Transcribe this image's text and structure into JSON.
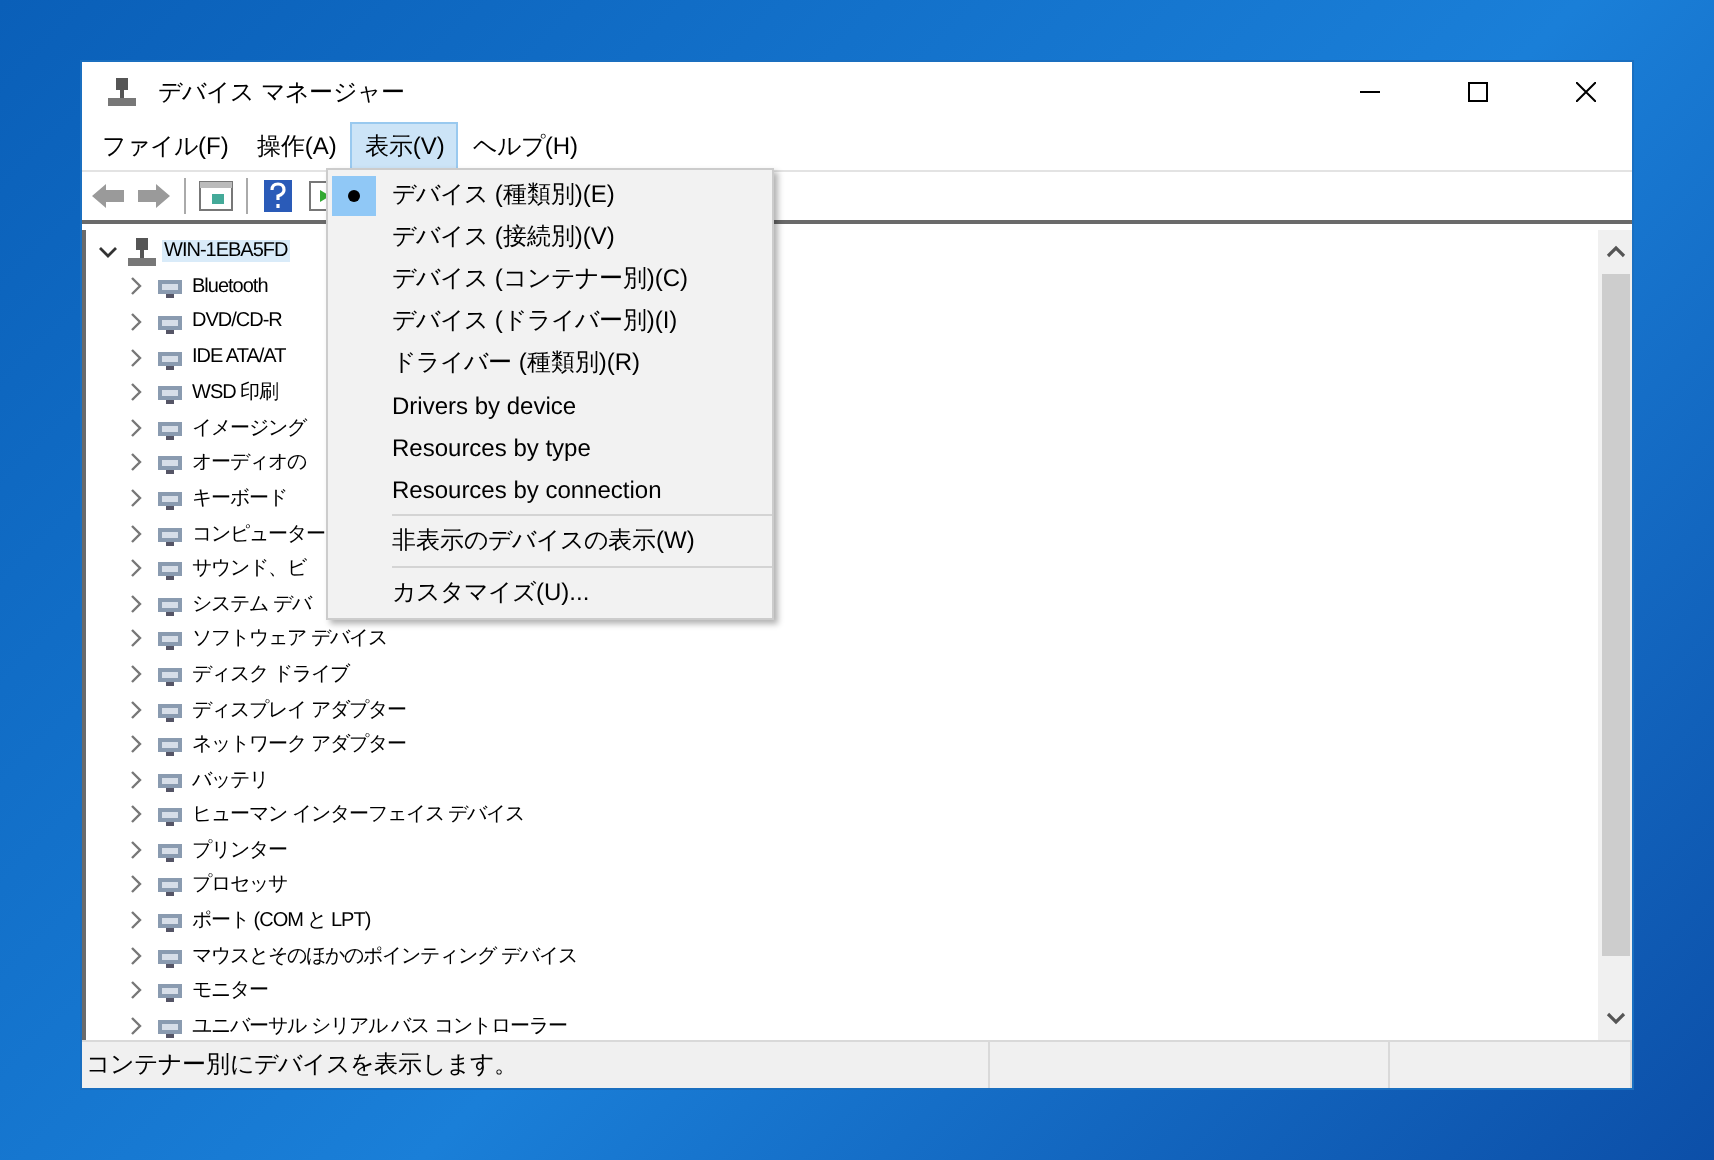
{
  "window": {
    "title": "デバイス マネージャー"
  },
  "menu_bar": [
    {
      "label": "ファイル(F)",
      "selected": false
    },
    {
      "label": "操作(A)",
      "selected": false
    },
    {
      "label": "表示(V)",
      "selected": true
    },
    {
      "label": "ヘルプ(H)",
      "selected": false
    }
  ],
  "view_menu": [
    {
      "kind": "item",
      "label": "デバイス (種類別)(E)",
      "checked": true
    },
    {
      "kind": "item",
      "label": "デバイス (接続別)(V)",
      "checked": false
    },
    {
      "kind": "item",
      "label": "デバイス (コンテナー別)(C)",
      "checked": false
    },
    {
      "kind": "item",
      "label": "デバイス (ドライバー別)(I)",
      "checked": false
    },
    {
      "kind": "item",
      "label": "ドライバー (種類別)(R)",
      "checked": false
    },
    {
      "kind": "item",
      "label": "Drivers by device",
      "checked": false
    },
    {
      "kind": "item",
      "label": "Resources by type",
      "checked": false
    },
    {
      "kind": "item",
      "label": "Resources by connection",
      "checked": false
    },
    {
      "kind": "separator"
    },
    {
      "kind": "item",
      "label": "非表示のデバイスの表示(W)",
      "checked": false
    },
    {
      "kind": "separator"
    },
    {
      "kind": "item",
      "label": "カスタマイズ(U)...",
      "checked": false
    }
  ],
  "tree": {
    "label": "WIN-1EBA5FD",
    "expanded": true,
    "selected": true,
    "children": [
      {
        "label": "Bluetooth",
        "expanded": false
      },
      {
        "label": "DVD/CD-R",
        "expanded": false
      },
      {
        "label": "IDE ATA/AT",
        "expanded": false
      },
      {
        "label": "WSD 印刷",
        "expanded": false
      },
      {
        "label": "イメージング",
        "expanded": false
      },
      {
        "label": "オーディオの",
        "expanded": false
      },
      {
        "label": "キーボード",
        "expanded": false
      },
      {
        "label": "コンピューター",
        "expanded": false
      },
      {
        "label": "サウンド、ビ",
        "expanded": false
      },
      {
        "label": "システム デバ",
        "expanded": false
      },
      {
        "label": "ソフトウェア デバイス",
        "expanded": false
      },
      {
        "label": "ディスク ドライブ",
        "expanded": false
      },
      {
        "label": "ディスプレイ アダプター",
        "expanded": false
      },
      {
        "label": "ネットワーク アダプター",
        "expanded": false
      },
      {
        "label": "バッテリ",
        "expanded": false
      },
      {
        "label": "ヒューマン インターフェイス デバイス",
        "expanded": false
      },
      {
        "label": "プリンター",
        "expanded": false
      },
      {
        "label": "プロセッサ",
        "expanded": false
      },
      {
        "label": "ポート (COM と LPT)",
        "expanded": false
      },
      {
        "label": "マウスとそのほかのポインティング デバイス",
        "expanded": false
      },
      {
        "label": "モニター",
        "expanded": false
      },
      {
        "label": "ユニバーサル シリアル バス コントローラー",
        "expanded": false
      }
    ]
  },
  "status_bar": [
    "コンテナー別にデバイスを表示します。"
  ]
}
